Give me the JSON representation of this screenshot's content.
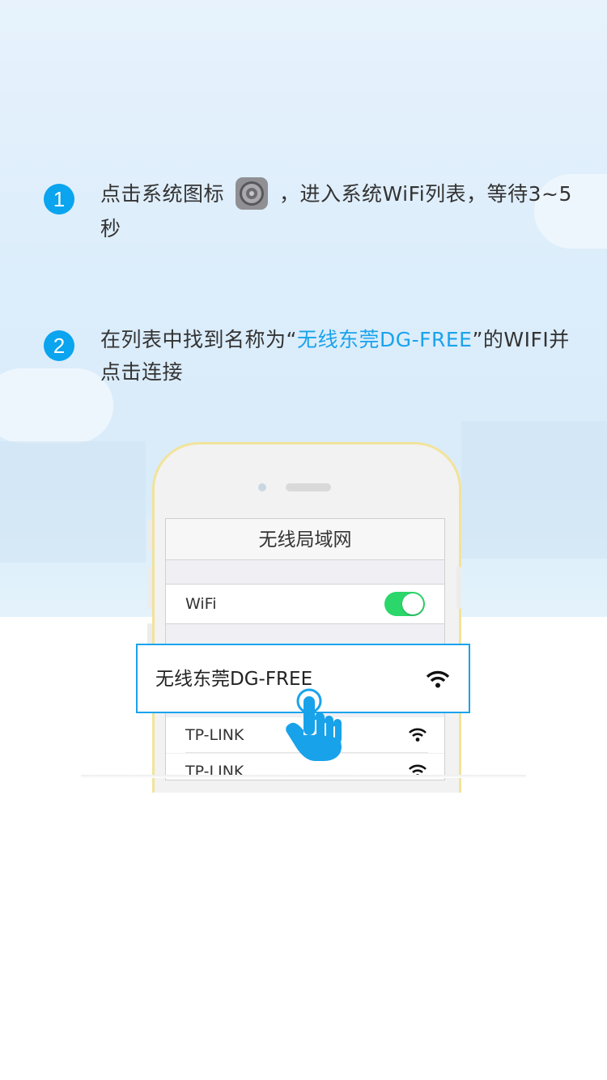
{
  "steps": [
    {
      "number": "1",
      "text_before": "点击系统图标",
      "icon": "settings-gear-icon",
      "text_after": "，进入系统WiFi列表，等待3~5秒"
    },
    {
      "number": "2",
      "text_before": "在列表中找到名称为“",
      "highlight": "无线东莞DG-FREE",
      "text_after": "”的WIFI并点击连接"
    }
  ],
  "phone_screen": {
    "title": "无线局域网",
    "wifi_label": "WiFi",
    "wifi_toggle_on": true,
    "networks": [
      "TP-LINK",
      "TP-LINK"
    ]
  },
  "highlighted_network": {
    "name": "无线东莞DG-FREE",
    "icon": "wifi-signal-icon"
  },
  "colors": {
    "accent": "#1aa3ec",
    "badge": "#0aa4ef",
    "toggle_on": "#2bd66a",
    "phone_frame": "#f2e39a"
  }
}
